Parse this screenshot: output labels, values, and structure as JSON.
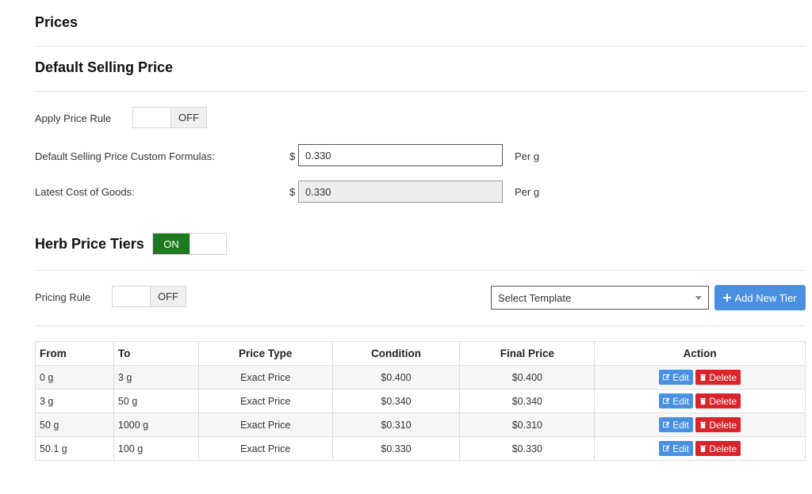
{
  "page": {
    "title": "Prices"
  },
  "default_selling": {
    "heading": "Default Selling Price",
    "apply_price_rule": {
      "label": "Apply Price Rule",
      "state": "OFF"
    },
    "custom_formula": {
      "label": "Default Selling Price Custom Formulas:",
      "currency": "$",
      "value": "0.330",
      "unit": "Per g"
    },
    "latest_cost": {
      "label": "Latest Cost of Goods:",
      "currency": "$",
      "value": "0.330",
      "unit": "Per g"
    }
  },
  "herb_tiers": {
    "heading": "Herb Price Tiers",
    "state": "ON",
    "pricing_rule": {
      "label": "Pricing Rule",
      "state": "OFF"
    },
    "template_select": {
      "value": "Select Template"
    },
    "add_button": "Add New Tier",
    "columns": [
      "From",
      "To",
      "Price Type",
      "Condition",
      "Final Price",
      "Action"
    ],
    "rows": [
      {
        "from": "0 g",
        "to": "3 g",
        "price_type": "Exact Price",
        "condition": "$0.400",
        "final_price": "$0.400"
      },
      {
        "from": "3 g",
        "to": "50 g",
        "price_type": "Exact Price",
        "condition": "$0.340",
        "final_price": "$0.340"
      },
      {
        "from": "50 g",
        "to": "1000 g",
        "price_type": "Exact Price",
        "condition": "$0.310",
        "final_price": "$0.310"
      },
      {
        "from": "50.1 g",
        "to": "100 g",
        "price_type": "Exact Price",
        "condition": "$0.330",
        "final_price": "$0.330"
      }
    ],
    "edit_label": "Edit",
    "delete_label": "Delete"
  },
  "colors": {
    "on_green": "#1e7a1e",
    "edit_blue": "#4a90e2",
    "delete_red": "#d9232d"
  }
}
